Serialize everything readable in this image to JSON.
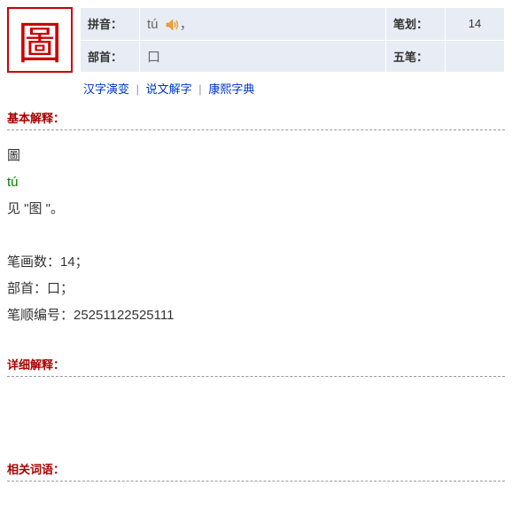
{
  "character": "圖",
  "labels": {
    "pinyin": "拼音：",
    "strokes": "笔划：",
    "radical": "部首：",
    "wubi": "五笔："
  },
  "info": {
    "pinyin": "tú",
    "pinyin_suffix": "，",
    "strokes": "14",
    "radical": "口",
    "wubi": ""
  },
  "links": {
    "evolution": "汉字演变",
    "shuowen": "说文解字",
    "kangxi": "康熙字典"
  },
  "sections": {
    "basic": "基本解释：",
    "detail": "详细解释：",
    "related": "相关词语："
  },
  "basic_content": {
    "char": "圖",
    "pinyin": "tú",
    "meaning": "见 \"图 \"。",
    "stroke_count": "笔画数：14；",
    "radical_line": "部首：口；",
    "order": "笔顺编号：25251122525111"
  }
}
